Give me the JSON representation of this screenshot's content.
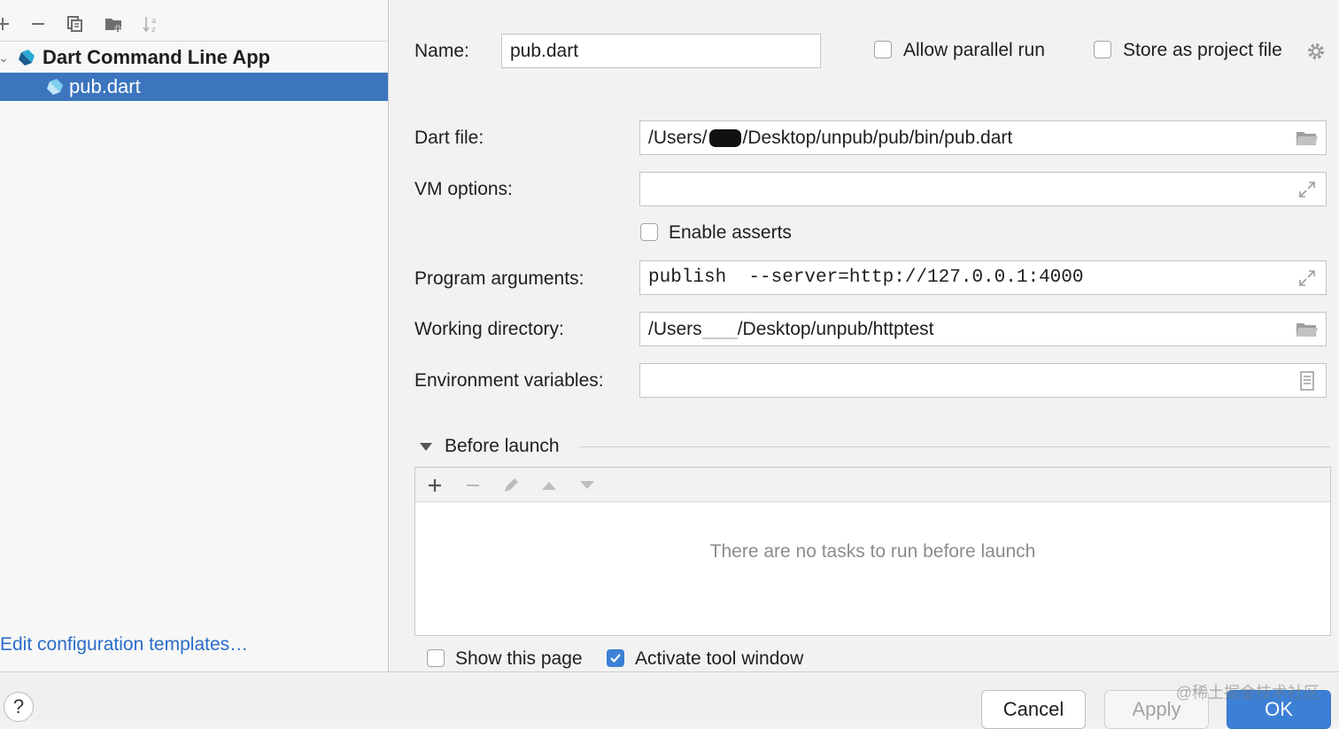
{
  "left": {
    "tree": {
      "group_label": "Dart Command Line App",
      "item_label": "pub.dart"
    },
    "edit_templates_label": "Edit configuration templates…"
  },
  "form": {
    "name_label": "Name:",
    "name_value": "pub.dart",
    "allow_parallel_label": "Allow parallel run",
    "allow_parallel_checked": false,
    "store_project_label": "Store as project file",
    "store_project_checked": false,
    "dart_file_label": "Dart file:",
    "dart_file_prefix": "/Users/",
    "dart_file_suffix": "/Desktop/unpub/pub/bin/pub.dart",
    "vm_options_label": "VM options:",
    "vm_options_value": "",
    "enable_asserts_label": "Enable asserts",
    "enable_asserts_checked": false,
    "program_args_label": "Program arguments:",
    "program_args_value": "publish  --server=http://127.0.0.1:4000",
    "working_dir_label": "Working directory:",
    "working_dir_prefix": "/Users",
    "working_dir_suffix": "/Desktop/unpub/httptest",
    "env_vars_label": "Environment variables:",
    "env_vars_value": ""
  },
  "before_launch": {
    "title": "Before launch",
    "empty_text": "There are no tasks to run before launch"
  },
  "options": {
    "show_page_label": "Show this page",
    "show_page_checked": false,
    "activate_tool_label": "Activate tool window",
    "activate_tool_checked": true
  },
  "buttons": {
    "help": "?",
    "cancel": "Cancel",
    "apply": "Apply",
    "ok": "OK"
  },
  "watermark": "@稀土掘金技术社区",
  "colors": {
    "selection": "#3c75be",
    "link": "#2a6cc9",
    "primary_button": "#3c80d6"
  }
}
